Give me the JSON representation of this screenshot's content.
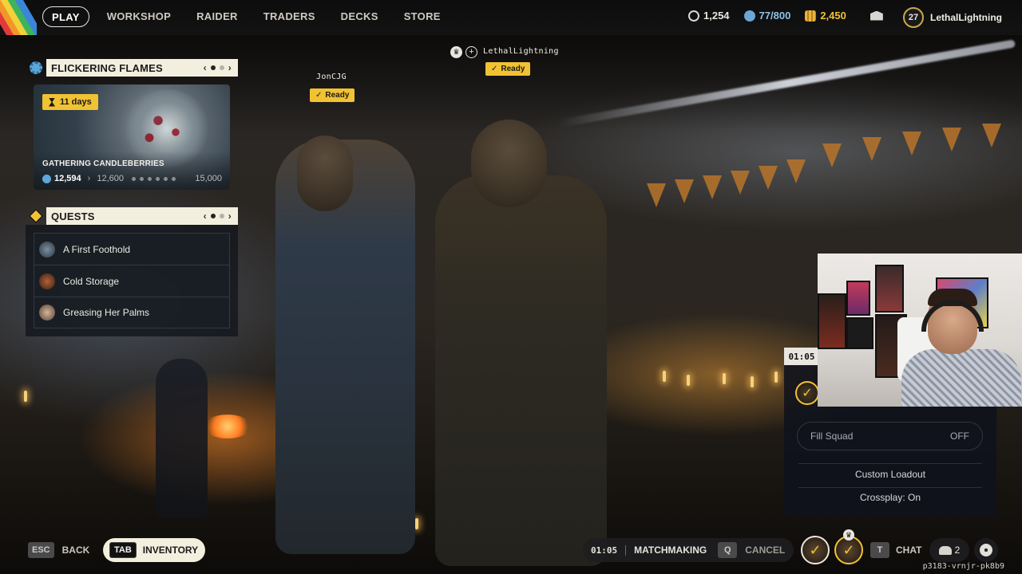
{
  "nav": {
    "items": [
      {
        "label": "PLAY",
        "active": true
      },
      {
        "label": "WORKSHOP",
        "active": false
      },
      {
        "label": "RAIDER",
        "active": false
      },
      {
        "label": "TRADERS",
        "active": false
      },
      {
        "label": "DECKS",
        "active": false
      },
      {
        "label": "STORE",
        "active": false
      }
    ]
  },
  "currencies": {
    "raider_tokens": {
      "value": "1,254",
      "icon": "raider-token-icon"
    },
    "cred": {
      "value": "77/800",
      "icon": "cred-coin-icon",
      "color": "#6aa6d6"
    },
    "coins": {
      "value": "2,450",
      "icon": "coin-stack-icon",
      "color": "#e9b53f"
    }
  },
  "profile": {
    "level": "27",
    "name": "LethalLightning"
  },
  "event": {
    "header": "FLICKERING FLAMES",
    "time_left": "11 days",
    "title": "GATHERING CANDLEBERRIES",
    "current": "12,594",
    "next": "12,600",
    "max": "15,000"
  },
  "quests": {
    "header": "QUESTS",
    "items": [
      {
        "label": "A First Foothold"
      },
      {
        "label": "Cold Storage"
      },
      {
        "label": "Greasing Her Palms"
      }
    ]
  },
  "squad": {
    "members": [
      {
        "name": "JonCJG",
        "status": "Ready"
      },
      {
        "name": "LethalLightning",
        "status": "Ready",
        "leader": true
      }
    ],
    "timer": "01:05",
    "fill_squad_label": "Fill Squad",
    "fill_squad_value": "OFF",
    "custom_loadout": "Custom Loadout",
    "crossplay": "Crossplay: On"
  },
  "bottom": {
    "back_key": "ESC",
    "back_label": "BACK",
    "inventory_key": "TAB",
    "inventory_label": "INVENTORY",
    "mm_timer": "01:05",
    "mm_label": "MATCHMAKING",
    "cancel_key": "Q",
    "cancel_label": "CANCEL",
    "chat_key": "T",
    "chat_label": "CHAT",
    "friends_count": "2",
    "session_id": "p3183-vrnjr-pk8b9"
  },
  "colors": {
    "accent_yellow": "#f1c232",
    "header_cream": "#f3efdf",
    "event_blue": "#5ea6d8"
  }
}
